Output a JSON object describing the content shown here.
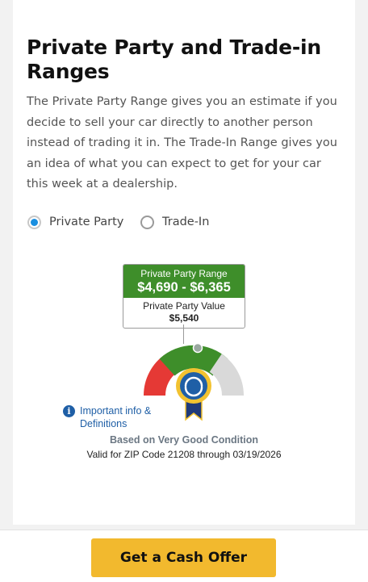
{
  "section": {
    "title": "Private Party and Trade-in Ranges",
    "description": "The Private Party Range gives you an estimate if you decide to sell your car directly to another person instead of trading it in. The Trade-In Range gives you an idea of what you can expect to get for your car this week at a dealership."
  },
  "options": {
    "private_party": {
      "label": "Private Party",
      "selected": true
    },
    "trade_in": {
      "label": "Trade-In",
      "selected": false
    }
  },
  "range": {
    "label": "Private Party Range",
    "value": "$4,690 - $6,365",
    "value_label": "Private Party Value",
    "value_amount": "$5,540"
  },
  "gauge": {
    "segment_colors": [
      "#e53935",
      "#3e8e2a",
      "#d9d9d9"
    ],
    "badge_colors": {
      "ribbon": "#1f3a7a",
      "seal": "#1f5fa6",
      "rim": "#f2c230"
    }
  },
  "info": {
    "label": "Important info & Definitions"
  },
  "condition": {
    "text": "Based on Very Good Condition"
  },
  "validity": {
    "text": "Valid for ZIP Code 21208 through 03/19/2026"
  },
  "footer": {
    "cta_label": "Get a Cash Offer"
  }
}
